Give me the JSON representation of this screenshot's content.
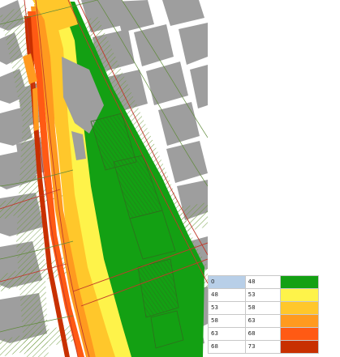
{
  "legend": {
    "rows": [
      {
        "from": "0",
        "to": "48",
        "color": "#13a013"
      },
      {
        "from": "48",
        "to": "53",
        "color": "#fef34a"
      },
      {
        "from": "53",
        "to": "58",
        "color": "#ffc72b"
      },
      {
        "from": "58",
        "to": "63",
        "color": "#ff9a1f"
      },
      {
        "from": "63",
        "to": "68",
        "color": "#ff5a14"
      },
      {
        "from": "68",
        "to": "73",
        "color": "#c83000"
      }
    ]
  },
  "colors": {
    "building": "#9e9e9e",
    "background": "#ffffff",
    "road_line": "#c0392b",
    "contour_line": "#5f8a3a"
  }
}
